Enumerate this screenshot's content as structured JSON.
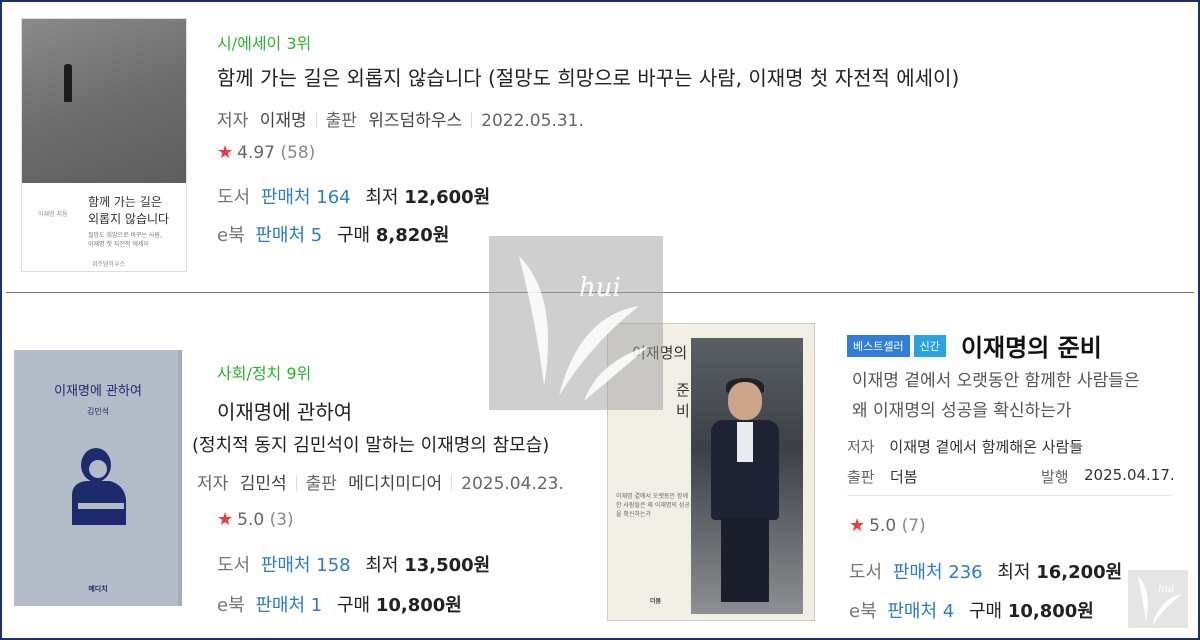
{
  "books": [
    {
      "rank": "시/에세이 3위",
      "title": "함께 가는 길은 외롭지 않습니다 (절망도 희망으로 바꾸는 사람, 이재명 첫 자전적 에세이)",
      "author_label": "저자",
      "author": "이재명",
      "publisher_label": "출판",
      "publisher": "위즈덤하우스",
      "date": "2022.05.31.",
      "rating": "4.97",
      "rating_count": "(58)",
      "print_label": "도서",
      "print_sellers": "판매처 164",
      "print_price_label": "최저",
      "print_price": "12,600원",
      "ebook_label": "e북",
      "ebook_sellers": "판매처 5",
      "ebook_price_label": "구매",
      "ebook_price": "8,820원",
      "cover": {
        "title_line1": "함께 가는 길은",
        "title_line2": "외롭지 않습니다",
        "subtitle_line1": "절망도 희망으로 바꾸는 사람,",
        "subtitle_line2": "이재명 첫 자전적 에세이",
        "author": "이재명 지음",
        "publisher": "위즈덤하우스"
      }
    },
    {
      "rank": "사회/정치 9위",
      "title": "이재명에 관하여",
      "subtitle": "(정치적 동지 김민석이 말하는 이재명의 참모습)",
      "author_label": "저자",
      "author": "김민석",
      "publisher_label": "출판",
      "publisher": "메디치미디어",
      "date": "2025.04.23.",
      "rating": "5.0",
      "rating_count": "(3)",
      "print_label": "도서",
      "print_sellers": "판매처 158",
      "print_price_label": "최저",
      "print_price": "13,500원",
      "ebook_label": "e북",
      "ebook_sellers": "판매처 1",
      "ebook_price_label": "구매",
      "ebook_price": "10,800원",
      "cover": {
        "title": "이재명에 관하여",
        "author": "김민석",
        "publisher": "메디치"
      }
    },
    {
      "badges": [
        "베스트셀러",
        "신간"
      ],
      "title": "이재명의 준비",
      "description_line1": "이재명 곁에서 오랫동안 함께한 사람들은",
      "description_line2": "왜 이재명의 성공을 확신하는가",
      "author_label": "저자",
      "author": "이재명 곁에서 함께해온 사람들",
      "publisher_label": "출판",
      "publisher": "더봄",
      "date_label": "발행",
      "date": "2025.04.17.",
      "rating": "5.0",
      "rating_count": "(7)",
      "print_label": "도서",
      "print_sellers": "판매처 236",
      "print_price_label": "최저",
      "print_price": "16,200원",
      "ebook_label": "e북",
      "ebook_sellers": "판매처 4",
      "ebook_price_label": "구매",
      "ebook_price": "10,800원",
      "cover": {
        "title_a": "이재명의",
        "title_b": "준",
        "title_c": "비",
        "subtitle": "이재명 곁에서 오랫동안 함께한 사람들은 왜 이재명의 성공을 확신하는가",
        "publisher": "더봄"
      }
    }
  ],
  "watermark": {
    "text": "hui"
  },
  "colors": {
    "frame": "#1f2f6e",
    "rank": "#2bb32b",
    "link": "#2a7bd1",
    "star": "#ef3b3b",
    "badge_best": "#2f7fd6",
    "badge_new": "#2aa3e0"
  }
}
